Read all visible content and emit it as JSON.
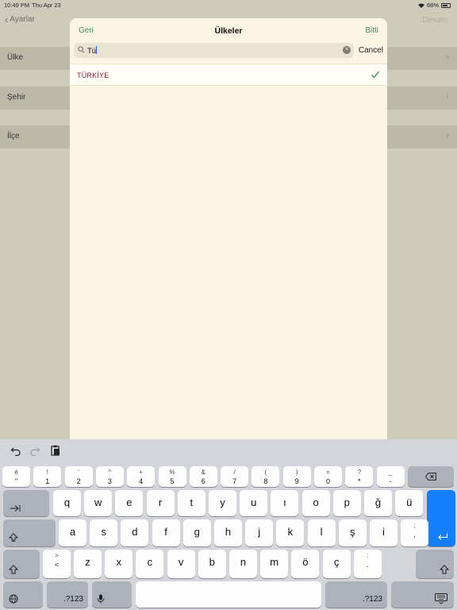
{
  "status_bar": {
    "time": "10:49 PM",
    "date": "Thu Apr 23",
    "battery": "68%"
  },
  "background": {
    "back_label": "Ayarlar",
    "continue_label": "Devam",
    "rows": [
      {
        "label": "Ülke"
      },
      {
        "label": "Şehir"
      },
      {
        "label": "İlçe"
      }
    ]
  },
  "modal": {
    "back_label": "Geri",
    "title": "Ülkeler",
    "done_label": "Bitti",
    "search_value": "Tü",
    "cancel_label": "Cancel",
    "results": [
      {
        "label": "TÜRKİYE",
        "selected": true
      }
    ]
  },
  "keyboard": {
    "number_row": [
      {
        "top": "é",
        "bot": "\""
      },
      {
        "top": "!",
        "bot": "1"
      },
      {
        "top": "'",
        "bot": "2"
      },
      {
        "top": "^",
        "bot": "3"
      },
      {
        "top": "+",
        "bot": "4"
      },
      {
        "top": "%",
        "bot": "5"
      },
      {
        "top": "&",
        "bot": "6"
      },
      {
        "top": "/",
        "bot": "7"
      },
      {
        "top": "(",
        "bot": "8"
      },
      {
        "top": ")",
        "bot": "9"
      },
      {
        "top": "=",
        "bot": "0"
      },
      {
        "top": "?",
        "bot": "*"
      },
      {
        "top": "_",
        "bot": "-"
      }
    ],
    "row1": [
      "q",
      "w",
      "e",
      "r",
      "t",
      "y",
      "u",
      "ı",
      "o",
      "p",
      "ğ",
      "ü"
    ],
    "row2": [
      "a",
      "s",
      "d",
      "f",
      "g",
      "h",
      "j",
      "k",
      "l",
      "ş",
      "i"
    ],
    "row2_punct": {
      "top": ";",
      "bot": ","
    },
    "row3_punct_left": {
      "top": ">",
      "bot": "<"
    },
    "row3": [
      "z",
      "x",
      "c",
      "v",
      "b",
      "n",
      "m",
      "ö",
      "ç"
    ],
    "row3_punct_right": {
      "top": ":",
      "bot": "."
    },
    "numbers_label": ".?123",
    "accent_color": "#147efb"
  }
}
